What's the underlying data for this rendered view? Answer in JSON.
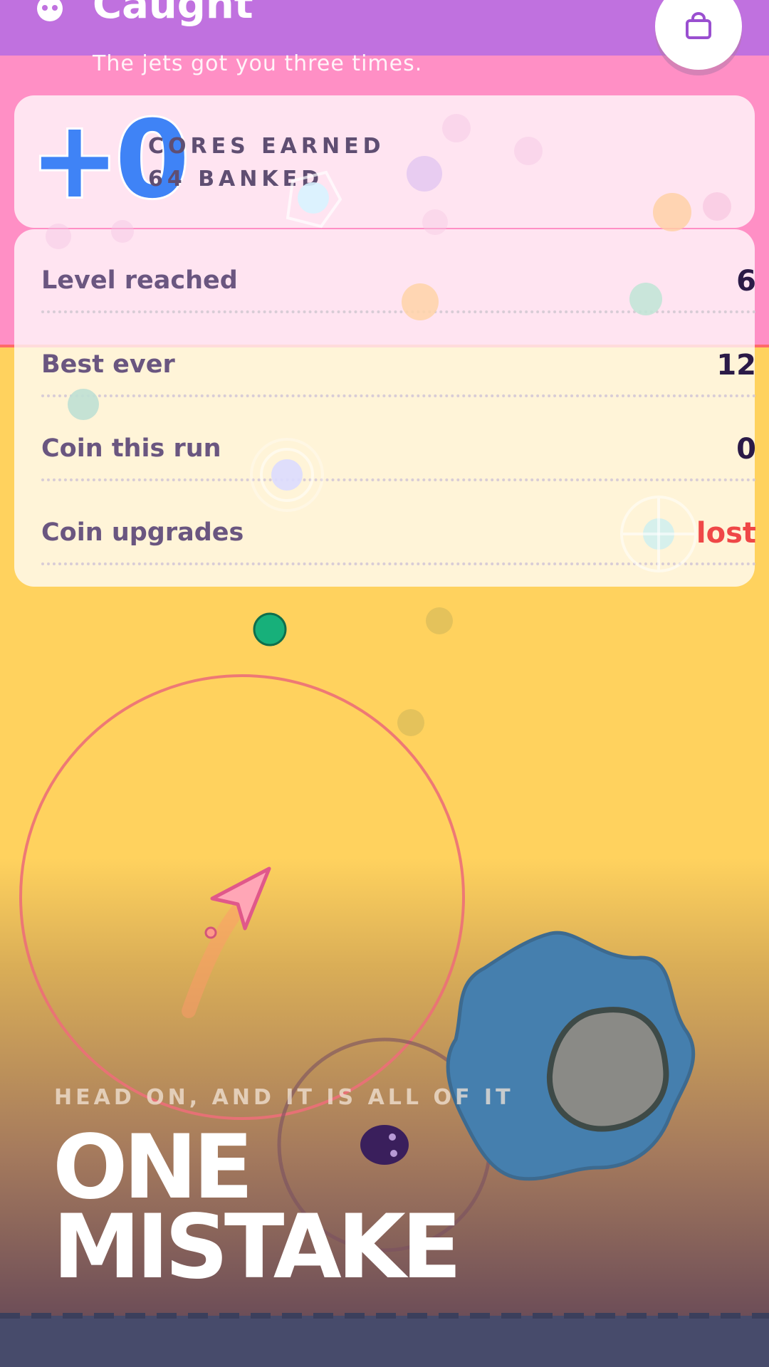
{
  "header": {
    "title": "Caught",
    "subtitle": "The jets got you three times.",
    "title_icon": "skull-icon",
    "shop_icon": "shopping-bag-icon"
  },
  "earn": {
    "value": "+0",
    "earned_label": "CORES EARNED",
    "banked_label": "64 BANKED"
  },
  "stats": [
    {
      "label": "Level reached",
      "value": "6"
    },
    {
      "label": "Best ever",
      "value": "12"
    },
    {
      "label": "Coin this run",
      "value": "0"
    },
    {
      "label": "Coin upgrades",
      "value": "lost",
      "value_color": "#ef4747"
    }
  ],
  "promo": {
    "tagline": "HEAD ON, AND IT IS ALL OF IT",
    "headline_line1": "ONE",
    "headline_line2": "MISTAKE"
  },
  "colors": {
    "header": "#c071df",
    "pink_zone": "#ff8fc5",
    "yellow_zone": "#ffd25e",
    "accent_blue": "#3f83f6",
    "danger_red": "#ef4747",
    "bottom_bar": "#474b6b"
  }
}
